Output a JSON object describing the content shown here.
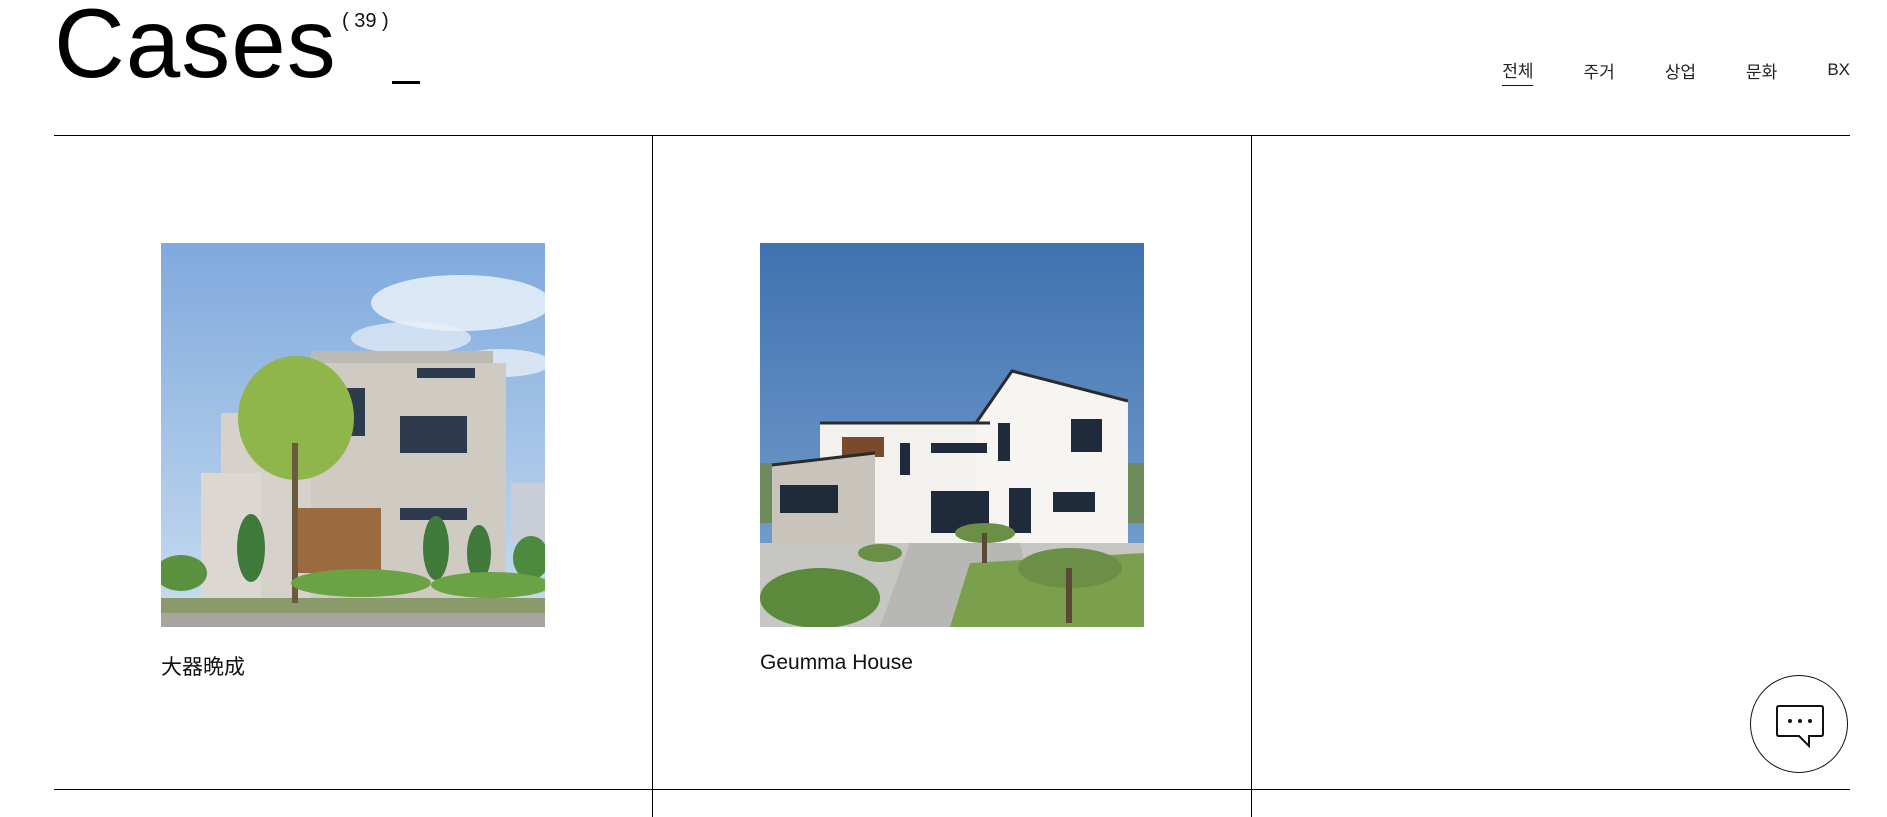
{
  "header": {
    "title": "Cases",
    "count": "( 39 )"
  },
  "filters": [
    {
      "label": "전체",
      "active": true
    },
    {
      "label": "주거",
      "active": false
    },
    {
      "label": "상업",
      "active": false
    },
    {
      "label": "문화",
      "active": false
    },
    {
      "label": "BX",
      "active": false
    }
  ],
  "cases": [
    {
      "title": "大器晩成",
      "image": "modern-grey-brick-house-photo"
    },
    {
      "title": "Geumma House",
      "image": "white-modern-house-photo"
    }
  ],
  "chat": {
    "icon": "chat-bubble-icon"
  },
  "colors": {
    "line": "#000000",
    "sky1": "#8fb5df",
    "sky2": "#3e74b4"
  }
}
